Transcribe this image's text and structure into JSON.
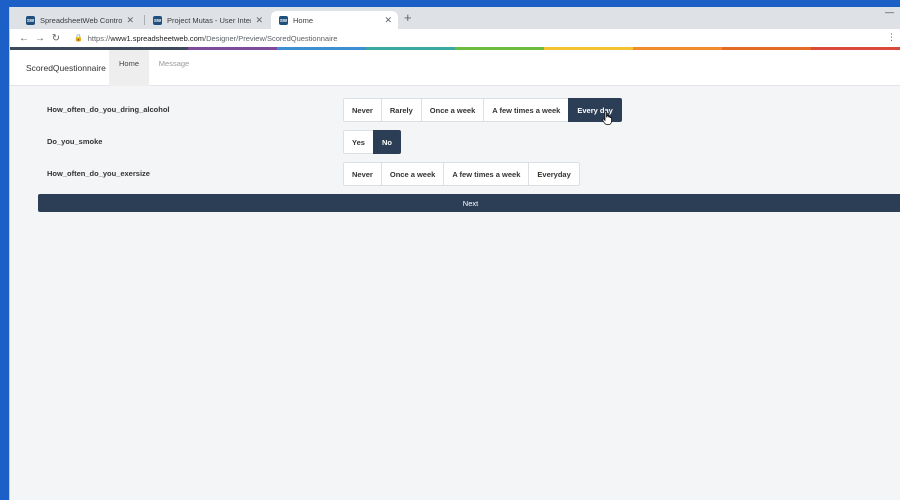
{
  "browser": {
    "tabs": [
      {
        "title": "SpreadsheetWeb Control Panel",
        "favicon": "SW",
        "active": false
      },
      {
        "title": "Project Mutas - User Interface De",
        "favicon": "SW",
        "active": false
      },
      {
        "title": "Home",
        "favicon": "SW",
        "active": true
      }
    ],
    "url_scheme": "https://",
    "url_host": "www1.spreadsheetweb.com",
    "url_path": "/Designer/Preview/ScoredQuestionnaire"
  },
  "colors": {
    "strip": [
      "#3d4a5b",
      "#3d4a5b",
      "#7d4b9a",
      "#3e8fd1",
      "#3aa9a2",
      "#6cbb3c",
      "#f2c230",
      "#f08c2c",
      "#e36b24",
      "#d94a3a"
    ],
    "primary": "#2c3e55"
  },
  "app": {
    "brand": "ScoredQuestionnaire",
    "nav": [
      {
        "label": "Home",
        "active": true
      },
      {
        "label": "Message",
        "active": false
      }
    ]
  },
  "questions": [
    {
      "label": "How_often_do_you_dring_alcohol",
      "options": [
        "Never",
        "Rarely",
        "Once a week",
        "A few times a week",
        "Every day"
      ],
      "selected": "Every day"
    },
    {
      "label": "Do_you_smoke",
      "options": [
        "Yes",
        "No"
      ],
      "selected": "No"
    },
    {
      "label": "How_often_do_you_exersize",
      "options": [
        "Never",
        "Once a week",
        "A few times a week",
        "Everyday"
      ],
      "selected": null
    }
  ],
  "next_label": "Next"
}
